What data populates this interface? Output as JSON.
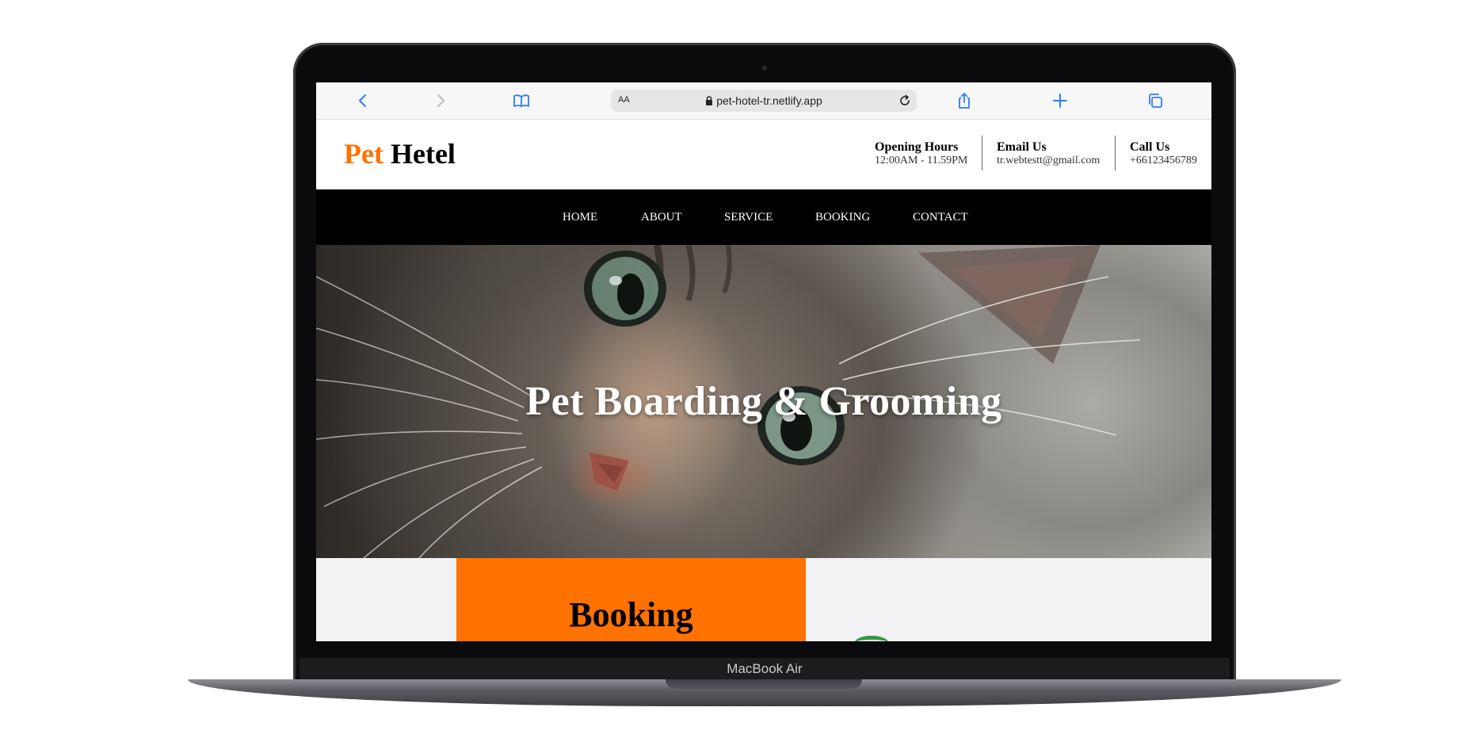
{
  "device": {
    "model_label": "MacBook Air"
  },
  "browser": {
    "text_size_label": "AA",
    "url": "pet-hotel-tr.netlify.app",
    "icons": [
      "back-icon",
      "forward-icon",
      "bookmarks-icon",
      "lock-icon",
      "reload-icon",
      "share-icon",
      "new-tab-icon",
      "tabs-icon"
    ]
  },
  "site": {
    "logo": {
      "part1": "Pet",
      "part2": "Hetel",
      "accent_color": "#ff7200"
    },
    "header_info": [
      {
        "title": "Opening Hours",
        "value": "12:00AM - 11.59PM"
      },
      {
        "title": "Email Us",
        "value": "tr.webtestt@gmail.com"
      },
      {
        "title": "Call Us",
        "value": "+66123456789"
      }
    ],
    "nav": [
      "HOME",
      "ABOUT",
      "SERVICE",
      "BOOKING",
      "CONTACT"
    ],
    "hero": {
      "title": "Pet Boarding & Grooming"
    },
    "booking": {
      "title": "Booking",
      "color": "#ff7200"
    }
  }
}
